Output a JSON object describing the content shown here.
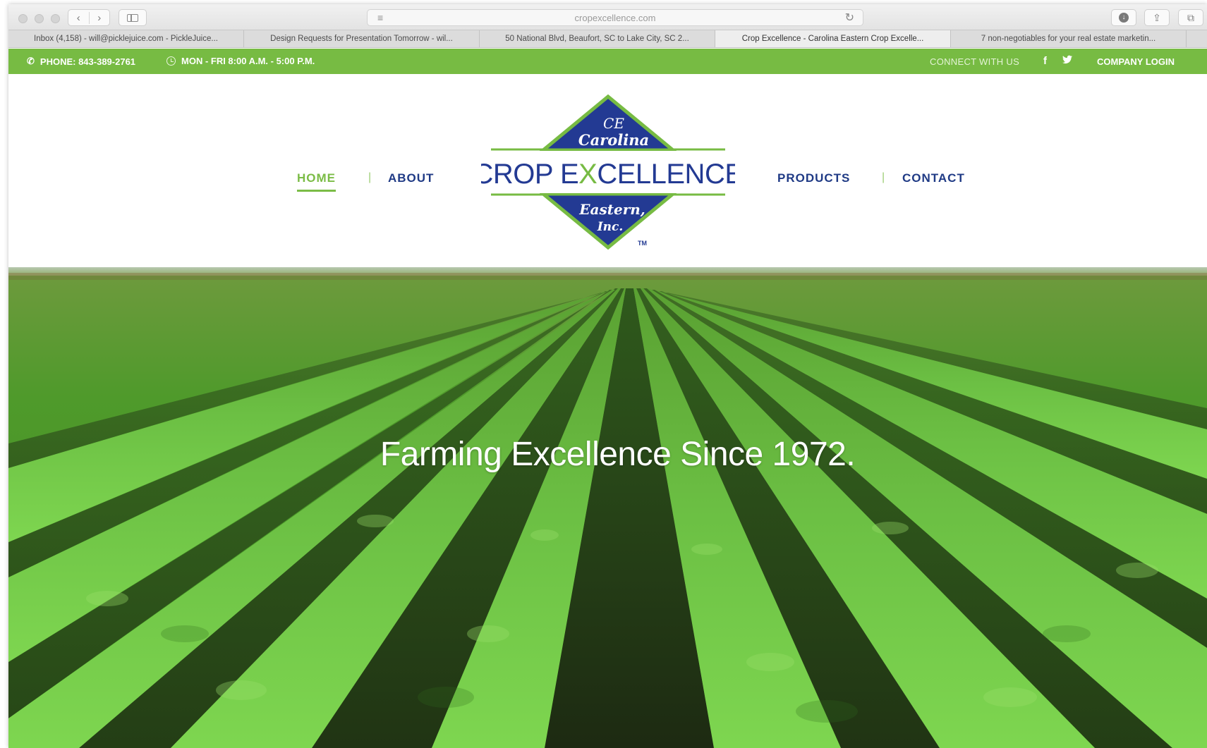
{
  "browser": {
    "url": "cropexcellence.com",
    "tabs": [
      {
        "label": "Inbox (4,158) - will@picklejuice.com - PickleJuice...",
        "active": false
      },
      {
        "label": "Design Requests for Presentation Tomorrow - wil...",
        "active": false
      },
      {
        "label": "50 National Blvd, Beaufort, SC to Lake City, SC 2...",
        "active": false
      },
      {
        "label": "Crop Excellence - Carolina Eastern Crop Excelle...",
        "active": true
      },
      {
        "label": "7 non-negotiables for your real estate marketin...",
        "active": false
      }
    ],
    "icons": {
      "back": "chevron-left-icon",
      "forward": "chevron-right-icon",
      "reload": "reload-icon",
      "download": "download-icon",
      "share": "share-icon",
      "tabs": "tabs-icon"
    }
  },
  "topbar": {
    "phone": "PHONE: 843-389-2761",
    "hours": "MON - FRI 8:00 A.M. - 5:00 P.M.",
    "connect": "CONNECT WITH US",
    "facebook": "f",
    "login": "COMPANY LOGIN",
    "color": "#77bb43"
  },
  "nav": {
    "home": "HOME",
    "about": "ABOUT",
    "products": "PRODUCTS",
    "contact": "CONTACT",
    "separator": "|",
    "active_color": "#7bbc46",
    "link_color": "#1f3a85"
  },
  "logo": {
    "monogram": "CE",
    "top": "Carolina",
    "name_part1": "CROP E",
    "name_part2": "CELLENCE",
    "bottom1": "Eastern,",
    "bottom2": "Inc.",
    "tm": "TM",
    "navy": "#233a93",
    "green": "#77bb43"
  },
  "hero": {
    "tagline": "Farming Excellence Since 1972."
  }
}
